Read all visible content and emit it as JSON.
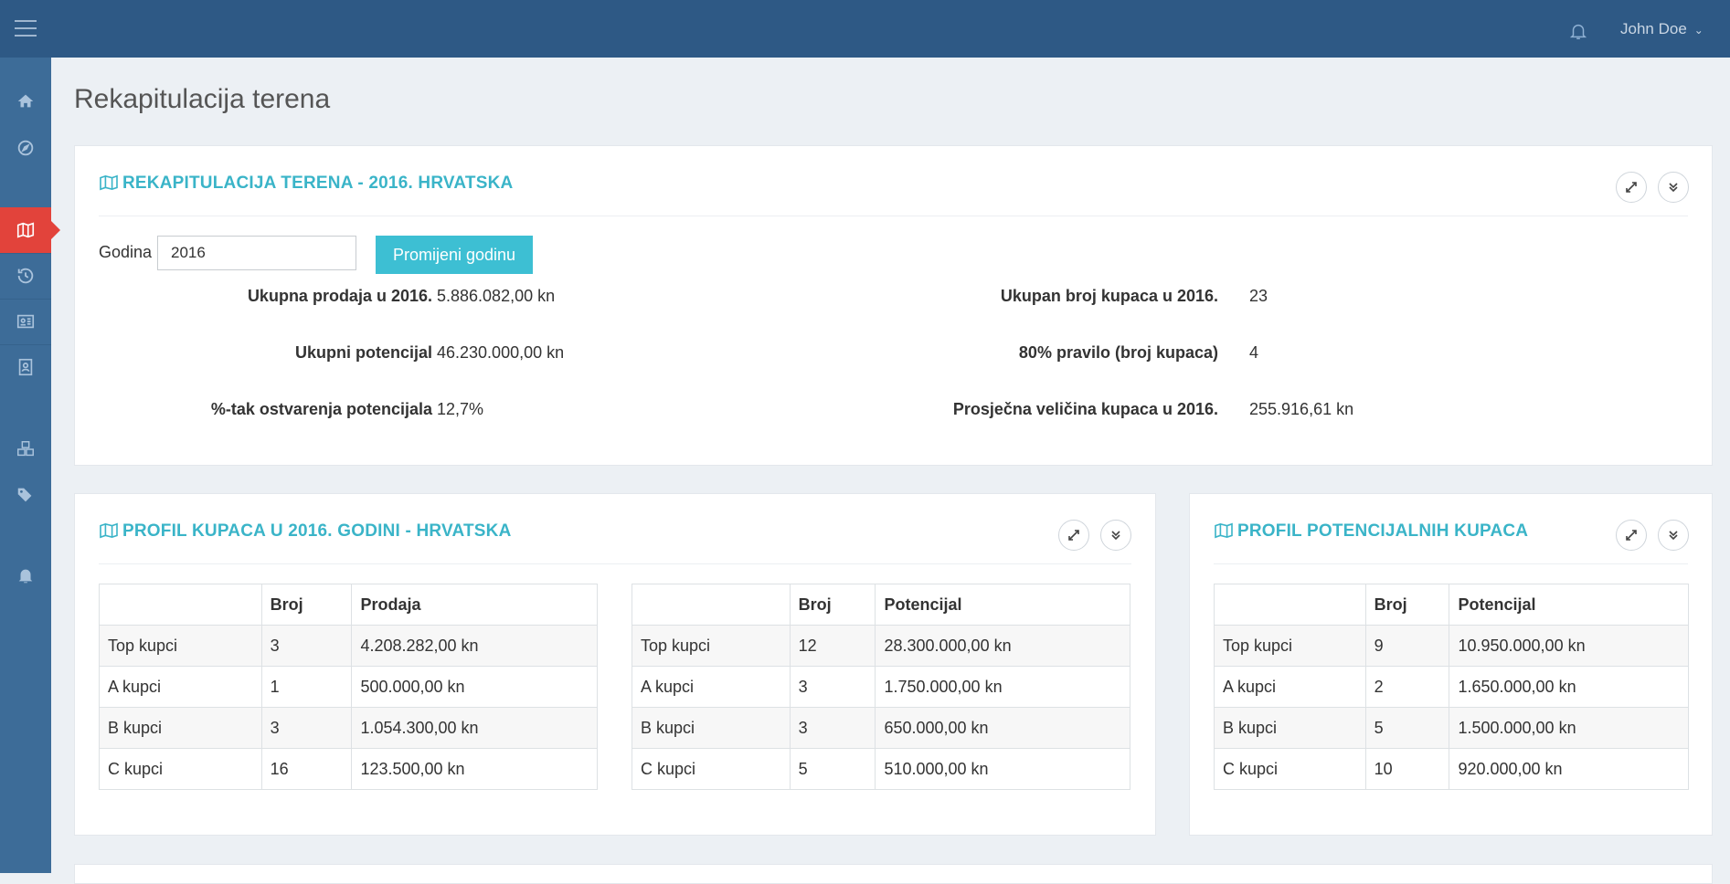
{
  "header": {
    "user_name": "John Doe"
  },
  "page": {
    "title": "Rekapitulacija terena"
  },
  "summary": {
    "title": "REKAPITULACIJA TERENA - 2016. HRVATSKA",
    "year_label": "Godina",
    "year_value": "2016",
    "change_year_button": "Promijeni godinu",
    "stats_left": [
      {
        "label": "Ukupna prodaja u 2016.",
        "value": "5.886.082,00 kn"
      },
      {
        "label": "Ukupni potencijal",
        "value": "46.230.000,00 kn"
      },
      {
        "label": "%-tak ostvarenja potencijala",
        "value": "12,7%"
      }
    ],
    "stats_right": [
      {
        "label": "Ukupan broj kupaca u 2016.",
        "value": "23"
      },
      {
        "label": "80% pravilo (broj kupaca)",
        "value": "4"
      },
      {
        "label": "Prosječna veličina kupaca u 2016.",
        "value": "255.916,61 kn"
      }
    ]
  },
  "profile": {
    "title": "PROFIL KUPACA U 2016. GODINI - HRVATSKA",
    "table1": {
      "headers": [
        "",
        "Broj",
        "Prodaja"
      ],
      "rows": [
        [
          "Top kupci",
          "3",
          "4.208.282,00 kn"
        ],
        [
          "A kupci",
          "1",
          "500.000,00 kn"
        ],
        [
          "B kupci",
          "3",
          "1.054.300,00 kn"
        ],
        [
          "C kupci",
          "16",
          "123.500,00 kn"
        ]
      ]
    },
    "table2": {
      "headers": [
        "",
        "Broj",
        "Potencijal"
      ],
      "rows": [
        [
          "Top kupci",
          "12",
          "28.300.000,00 kn"
        ],
        [
          "A kupci",
          "3",
          "1.750.000,00 kn"
        ],
        [
          "B kupci",
          "3",
          "650.000,00 kn"
        ],
        [
          "C kupci",
          "5",
          "510.000,00 kn"
        ]
      ]
    }
  },
  "potential": {
    "title": "PROFIL POTENCIJALNIH KUPACA",
    "table": {
      "headers": [
        "",
        "Broj",
        "Potencijal"
      ],
      "rows": [
        [
          "Top kupci",
          "9",
          "10.950.000,00 kn"
        ],
        [
          "A kupci",
          "2",
          "1.650.000,00 kn"
        ],
        [
          "B kupci",
          "5",
          "1.500.000,00 kn"
        ],
        [
          "C kupci",
          "10",
          "920.000,00 kn"
        ]
      ]
    }
  },
  "sidebar": {
    "icons": [
      "home-icon",
      "compass-icon",
      "map-icon",
      "history-icon",
      "id-card-icon",
      "contact-book-icon",
      "cubes-icon",
      "tags-icon",
      "bell-icon"
    ],
    "active": "map-icon"
  },
  "colors": {
    "topbar": "#2e5985",
    "sidebar": "#3d6c98",
    "accent": "#3ab4c8",
    "active": "#e2433b"
  }
}
